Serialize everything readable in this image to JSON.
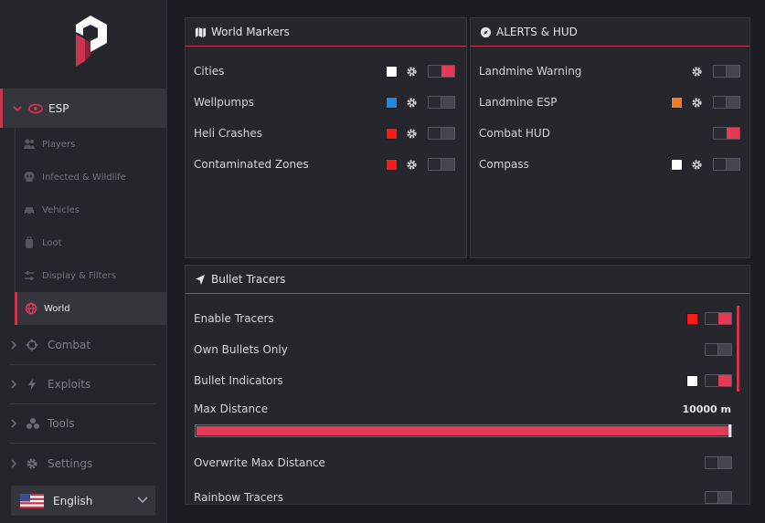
{
  "sidebar": {
    "esp_label": "ESP",
    "sub_items": [
      {
        "label": "Players",
        "icon": "players-icon"
      },
      {
        "label": "Infected & Wildlife",
        "icon": "skull-icon"
      },
      {
        "label": "Vehicles",
        "icon": "car-icon"
      },
      {
        "label": "Loot",
        "icon": "backpack-icon"
      },
      {
        "label": "Display & Filters",
        "icon": "sliders-icon"
      },
      {
        "label": "World",
        "icon": "globe-icon",
        "active": true
      }
    ],
    "main_items": [
      {
        "label": "Combat",
        "icon": "crosshair-icon"
      },
      {
        "label": "Exploits",
        "icon": "bolt-icon"
      },
      {
        "label": "Tools",
        "icon": "tools-icon"
      },
      {
        "label": "Settings",
        "icon": "gear-icon"
      }
    ],
    "language": "English"
  },
  "world_markers": {
    "title": "World Markers",
    "rows": [
      {
        "label": "Cities",
        "color": "#ffffff",
        "enabled": true
      },
      {
        "label": "Wellpumps",
        "color": "#1e88e5",
        "enabled": false
      },
      {
        "label": "Heli Crashes",
        "color": "#ff1a1a",
        "enabled": false
      },
      {
        "label": "Contaminated Zones",
        "color": "#ff1a1a",
        "enabled": false
      }
    ]
  },
  "alerts_hud": {
    "title": "ALERTS & HUD",
    "rows": [
      {
        "label": "Landmine Warning",
        "color": null,
        "gear": true,
        "enabled": false
      },
      {
        "label": "Landmine ESP",
        "color": "#f07a25",
        "gear": true,
        "enabled": false
      },
      {
        "label": "Combat HUD",
        "color": null,
        "gear": false,
        "enabled": true
      },
      {
        "label": "Compass",
        "color": "#ffffff",
        "gear": true,
        "enabled": false
      }
    ]
  },
  "bullet_tracers": {
    "title": "Bullet Tracers",
    "rows": [
      {
        "label": "Enable Tracers",
        "color": "#ff1a1a",
        "enabled": true
      },
      {
        "label": "Own Bullets Only",
        "color": null,
        "enabled": false
      },
      {
        "label": "Bullet Indicators",
        "color": "#ffffff",
        "enabled": true
      }
    ],
    "max_distance_label": "Max Distance",
    "max_distance_value": "10000 m",
    "max_distance_fraction": 1.0,
    "overwrite_label": "Overwrite Max Distance",
    "overwrite_enabled": false,
    "partial_label": "Rainbow Tracers"
  },
  "colors": {
    "accent": "#e43a57"
  }
}
